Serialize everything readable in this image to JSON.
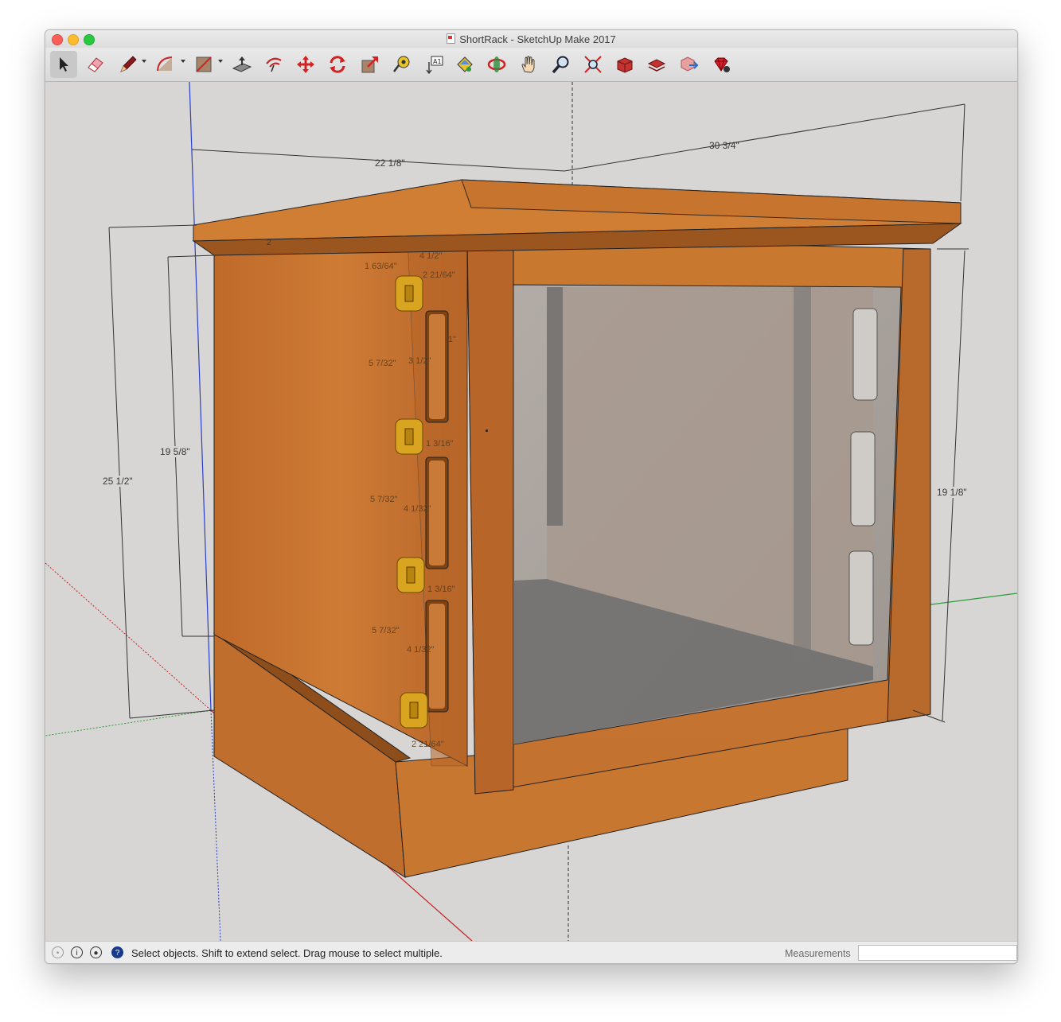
{
  "window": {
    "title": "ShortRack - SketchUp Make 2017"
  },
  "toolbar": {
    "tools": [
      {
        "name": "select-tool",
        "icon": "arrow-icon",
        "selected": true
      },
      {
        "name": "eraser-tool",
        "icon": "eraser-icon"
      },
      {
        "name": "line-tool",
        "icon": "pencil-icon",
        "dropdown": true
      },
      {
        "name": "arc-tool",
        "icon": "arc-icon",
        "dropdown": true
      },
      {
        "name": "rectangle-tool",
        "icon": "rectangle-icon",
        "dropdown": true
      },
      {
        "name": "push-pull-tool",
        "icon": "push-pull-icon"
      },
      {
        "name": "offset-tool",
        "icon": "offset-icon"
      },
      {
        "name": "move-tool",
        "icon": "move-icon"
      },
      {
        "name": "rotate-tool",
        "icon": "rotate-icon"
      },
      {
        "name": "scale-tool",
        "icon": "scale-icon"
      },
      {
        "name": "tape-measure-tool",
        "icon": "tape-measure-icon"
      },
      {
        "name": "text-tool",
        "icon": "text-icon"
      },
      {
        "name": "paint-bucket-tool",
        "icon": "paint-bucket-icon"
      },
      {
        "name": "orbit-tool",
        "icon": "orbit-icon"
      },
      {
        "name": "pan-tool",
        "icon": "hand-icon"
      },
      {
        "name": "zoom-tool",
        "icon": "magnifier-icon"
      },
      {
        "name": "zoom-extents-tool",
        "icon": "zoom-extents-icon"
      },
      {
        "name": "3d-warehouse-tool",
        "icon": "warehouse-icon"
      },
      {
        "name": "extension-warehouse-tool",
        "icon": "extension-warehouse-icon"
      },
      {
        "name": "share-model-tool",
        "icon": "share-model-icon"
      },
      {
        "name": "extension-manager-tool",
        "icon": "ruby-gem-icon"
      }
    ]
  },
  "dimensions": {
    "width_top": "30 3/4\"",
    "depth_top": "22 1/8\"",
    "height_total": "25 1/2\"",
    "height_side": "19 5/8\"",
    "height_front": "19 1/8\"",
    "top_edge": "2"
  },
  "inner_dimensions": [
    "1 63/64\"",
    "4 1/2\"",
    "2 21/64\"",
    "1\"",
    "5 7/32\"",
    "3 1/2\"",
    "1 3/16\"",
    "5 7/32\"",
    "4 1/32\"",
    "1 3/16\"",
    "5 7/32\"",
    "4 1/32\"",
    "2 21/64\""
  ],
  "statusbar": {
    "message": "Select objects. Shift to extend select. Drag mouse to select multiple.",
    "measurements_label": "Measurements",
    "measurements_value": ""
  },
  "colors": {
    "viewport_bg": "#d7d6d4",
    "wood_light": "#c9752e",
    "wood_dark": "#9c5620",
    "glass": "#a79e98",
    "hinge": "#d9a520"
  }
}
